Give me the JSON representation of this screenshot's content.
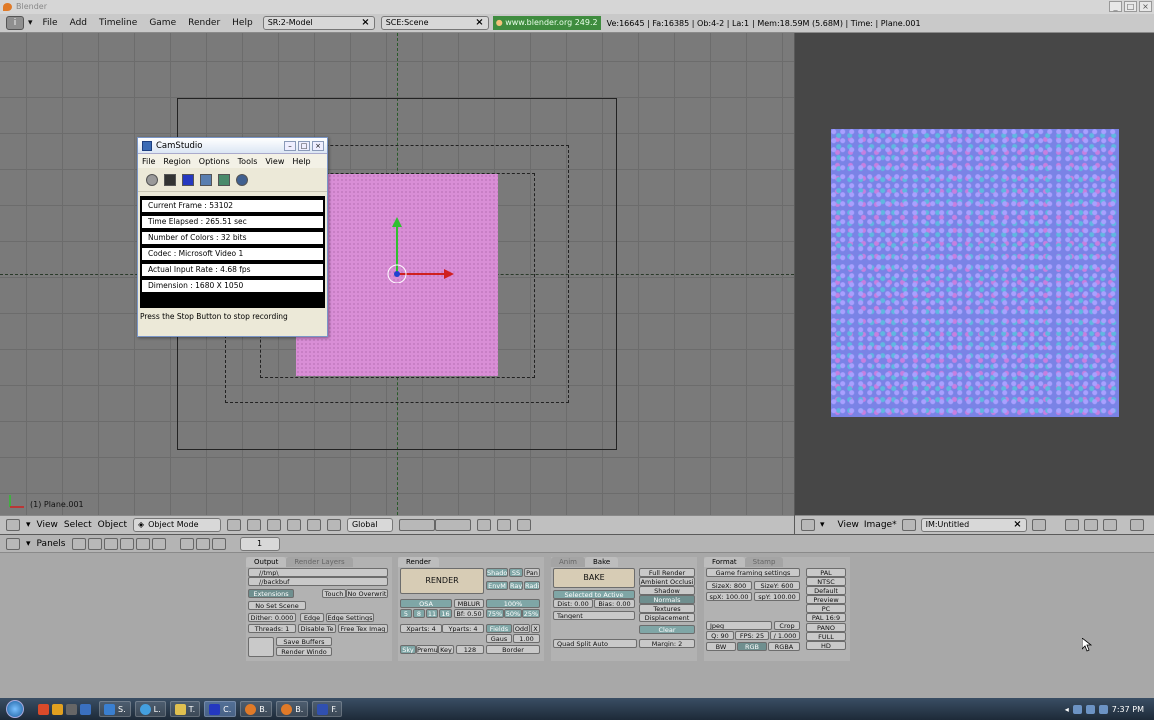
{
  "window": {
    "title": "Blender",
    "min": "_",
    "max": "□",
    "close": "×"
  },
  "topmenu": {
    "info_icon": "i",
    "items": [
      "File",
      "Add",
      "Timeline",
      "Game",
      "Render",
      "Help"
    ],
    "screen_field": "SR:2-Model",
    "scene_field": "SCE:Scene",
    "url": "www.blender.org 249.2",
    "stats": "Ve:16645 | Fa:16385 | Ob:4-2 | La:1",
    "mem": "| Mem:18.59M (5.68M) | Time: | Plane.001"
  },
  "viewport": {
    "object_label": "(1) Plane.001",
    "header": {
      "view": "View",
      "select": "Select",
      "object": "Object",
      "mode": "Object Mode",
      "orientation": "Global"
    }
  },
  "image_editor": {
    "header": {
      "view": "View",
      "image": "Image*",
      "image_name": "IM:Untitled"
    }
  },
  "buttons_header": {
    "panels": "Panels",
    "frame": "1"
  },
  "output_panel": {
    "tabs": [
      "Output",
      "Render Layers"
    ],
    "path1": "//tmp\\",
    "path2": "//backbuf",
    "extensions": "Extensions",
    "touch": "Touch",
    "no_overwrite": "No Overwrit",
    "no_set_scene": "No Set Scene",
    "dither": "Dither: 0.000",
    "edge": "Edge",
    "edge_settings": "Edge Settings",
    "threads": "Threads: 1",
    "disable_te": "Disable Te",
    "free_tex": "Free Tex Imag",
    "save_buffers": "Save Buffers",
    "render_window": "Render Windo"
  },
  "render_panel": {
    "tab": "Render",
    "render": "RENDER",
    "shadow": "Shado",
    "ss": "SS",
    "pan": "Pan",
    "envmap": "EnvM",
    "ray": "Ray",
    "radio": "Radi",
    "osa": "OSA",
    "mblur": "MBLUR",
    "percent": "100%",
    "osa_vals": [
      "5",
      "8",
      "11",
      "16"
    ],
    "bf": "Bf: 0.50",
    "pcts": [
      "75%",
      "50%",
      "25%"
    ],
    "xparts": "Xparts: 4",
    "yparts": "Yparts: 4",
    "fields": "Fields",
    "odd": "Odd",
    "x": "X",
    "gauss": "Gaus",
    "gauss_val": "1.00",
    "sky": "Sky",
    "premul": "Premu",
    "key": "Key",
    "bits": "128",
    "border": "Border"
  },
  "bake_panel": {
    "tabs": [
      "Anim",
      "Bake"
    ],
    "bake": "BAKE",
    "full_render": "Full Render",
    "ambient": "Ambient Occlusi",
    "shadow": "Shadow",
    "normals": "Normals",
    "textures": "Textures",
    "displacement": "Displacement",
    "selected_to_active": "Selected to Active",
    "dist": "Dist: 0.00",
    "bias": "Bias: 0.00",
    "tangent": "Tangent",
    "clear": "Clear",
    "quad_split": "Quad Split Auto",
    "margin": "Margin: 2"
  },
  "format_panel": {
    "tabs": [
      "Format",
      "Stamp"
    ],
    "game_framing": "Game framing settings",
    "sizex": "SizeX: 800",
    "sizey": "SizeY: 600",
    "aspx": "spX: 100.00",
    "aspy": "spY: 100.00",
    "codec": "Jpeg",
    "crop": "Crop",
    "quality": "Q: 90",
    "fps": "FPS: 25",
    "fps_base": "/ 1.000",
    "bw": "BW",
    "rgb": "RGB",
    "rgba": "RGBA",
    "presets": [
      "PAL",
      "NTSC",
      "Default",
      "Preview",
      "PC",
      "PAL 16:9",
      "PANO",
      "FULL",
      "HD"
    ]
  },
  "camstudio": {
    "title": "CamStudio",
    "menu": [
      "File",
      "Region",
      "Options",
      "Tools",
      "View",
      "Help"
    ],
    "rows": [
      "Current Frame : 53102",
      "Time Elapsed : 265.51 sec",
      "Number of Colors : 32 bits",
      "Codec : Microsoft Video 1",
      "Actual Input Rate : 4.68 fps",
      "Dimension : 1680 X 1050"
    ],
    "status": "Press the Stop Button to stop recording"
  },
  "taskbar": {
    "buttons": [
      "S.",
      "L.",
      "T.",
      "C.",
      "B.",
      "B.",
      "F."
    ],
    "clock": "7:37 PM"
  }
}
